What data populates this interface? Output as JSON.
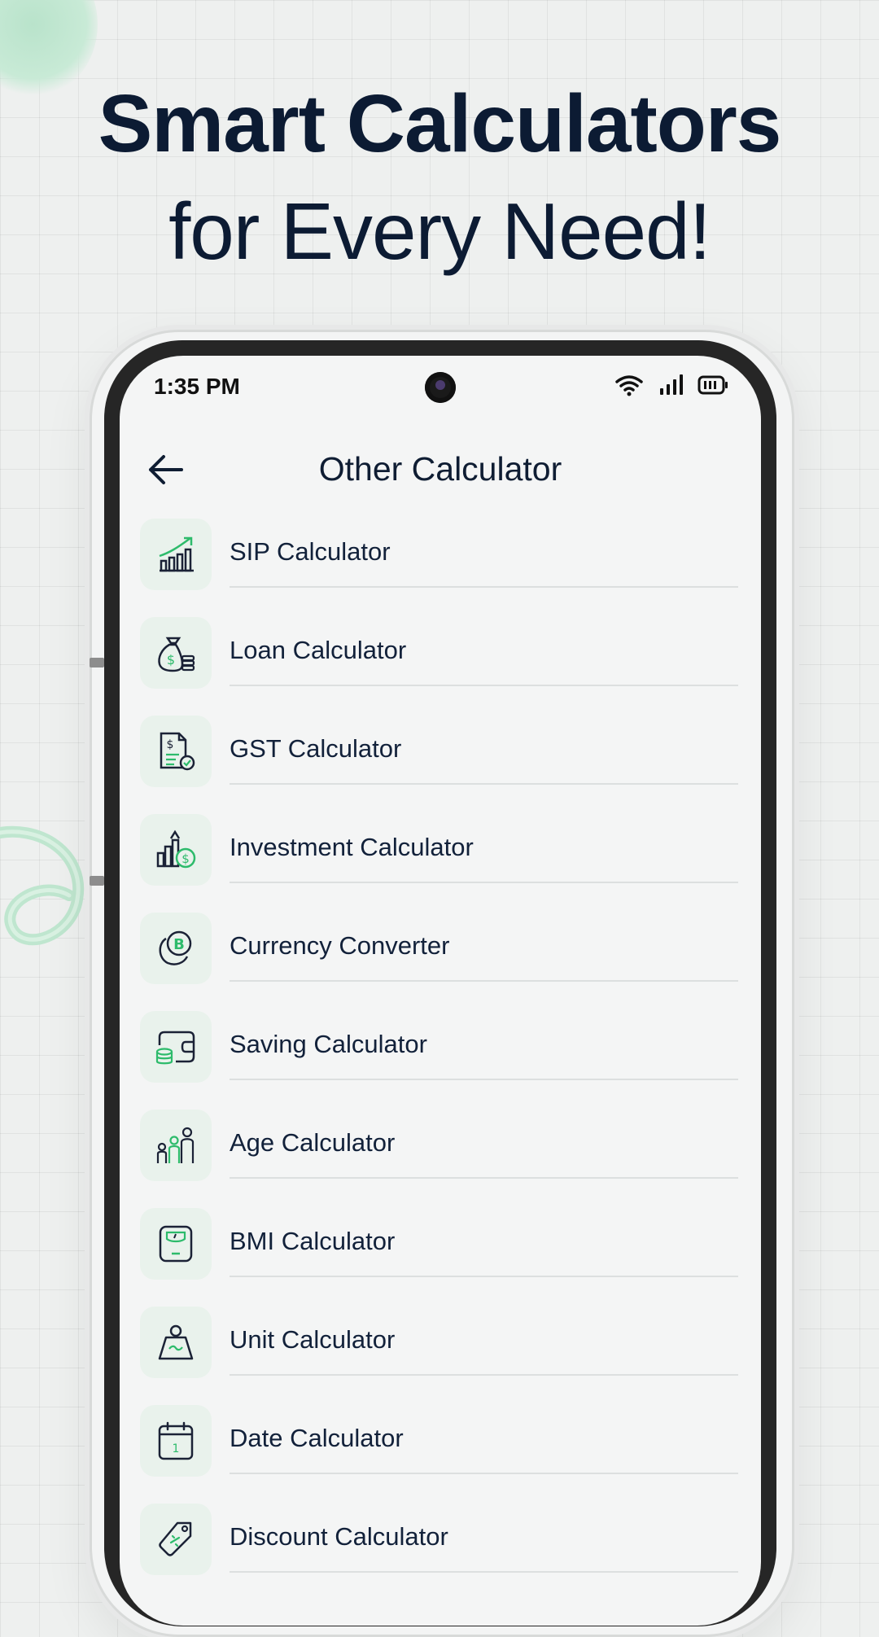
{
  "promo": {
    "headline_line1": "Smart Calculators",
    "headline_line2": "for Every Need!"
  },
  "status_bar": {
    "time": "1:35 PM",
    "icons": [
      "wifi-icon",
      "signal-icon",
      "battery-icon"
    ]
  },
  "app_bar": {
    "title": "Other Calculator",
    "back_icon": "arrow-left-icon"
  },
  "calculators": [
    {
      "label": "SIP Calculator",
      "icon": "growth-chart-icon"
    },
    {
      "label": "Loan Calculator",
      "icon": "money-bag-icon"
    },
    {
      "label": "GST Calculator",
      "icon": "invoice-icon"
    },
    {
      "label": "Investment Calculator",
      "icon": "investment-icon"
    },
    {
      "label": "Currency Converter",
      "icon": "currency-coin-icon"
    },
    {
      "label": "Saving Calculator",
      "icon": "wallet-icon"
    },
    {
      "label": "Age Calculator",
      "icon": "family-icon"
    },
    {
      "label": "BMI Calculator",
      "icon": "scale-icon"
    },
    {
      "label": "Unit Calculator",
      "icon": "weight-icon"
    },
    {
      "label": "Date Calculator",
      "icon": "calendar-icon"
    },
    {
      "label": "Discount Calculator",
      "icon": "tag-icon"
    }
  ],
  "colors": {
    "accent": "#2dbb6b",
    "icon_stroke": "#1b2236",
    "icon_bg": "#e9f2ec"
  }
}
